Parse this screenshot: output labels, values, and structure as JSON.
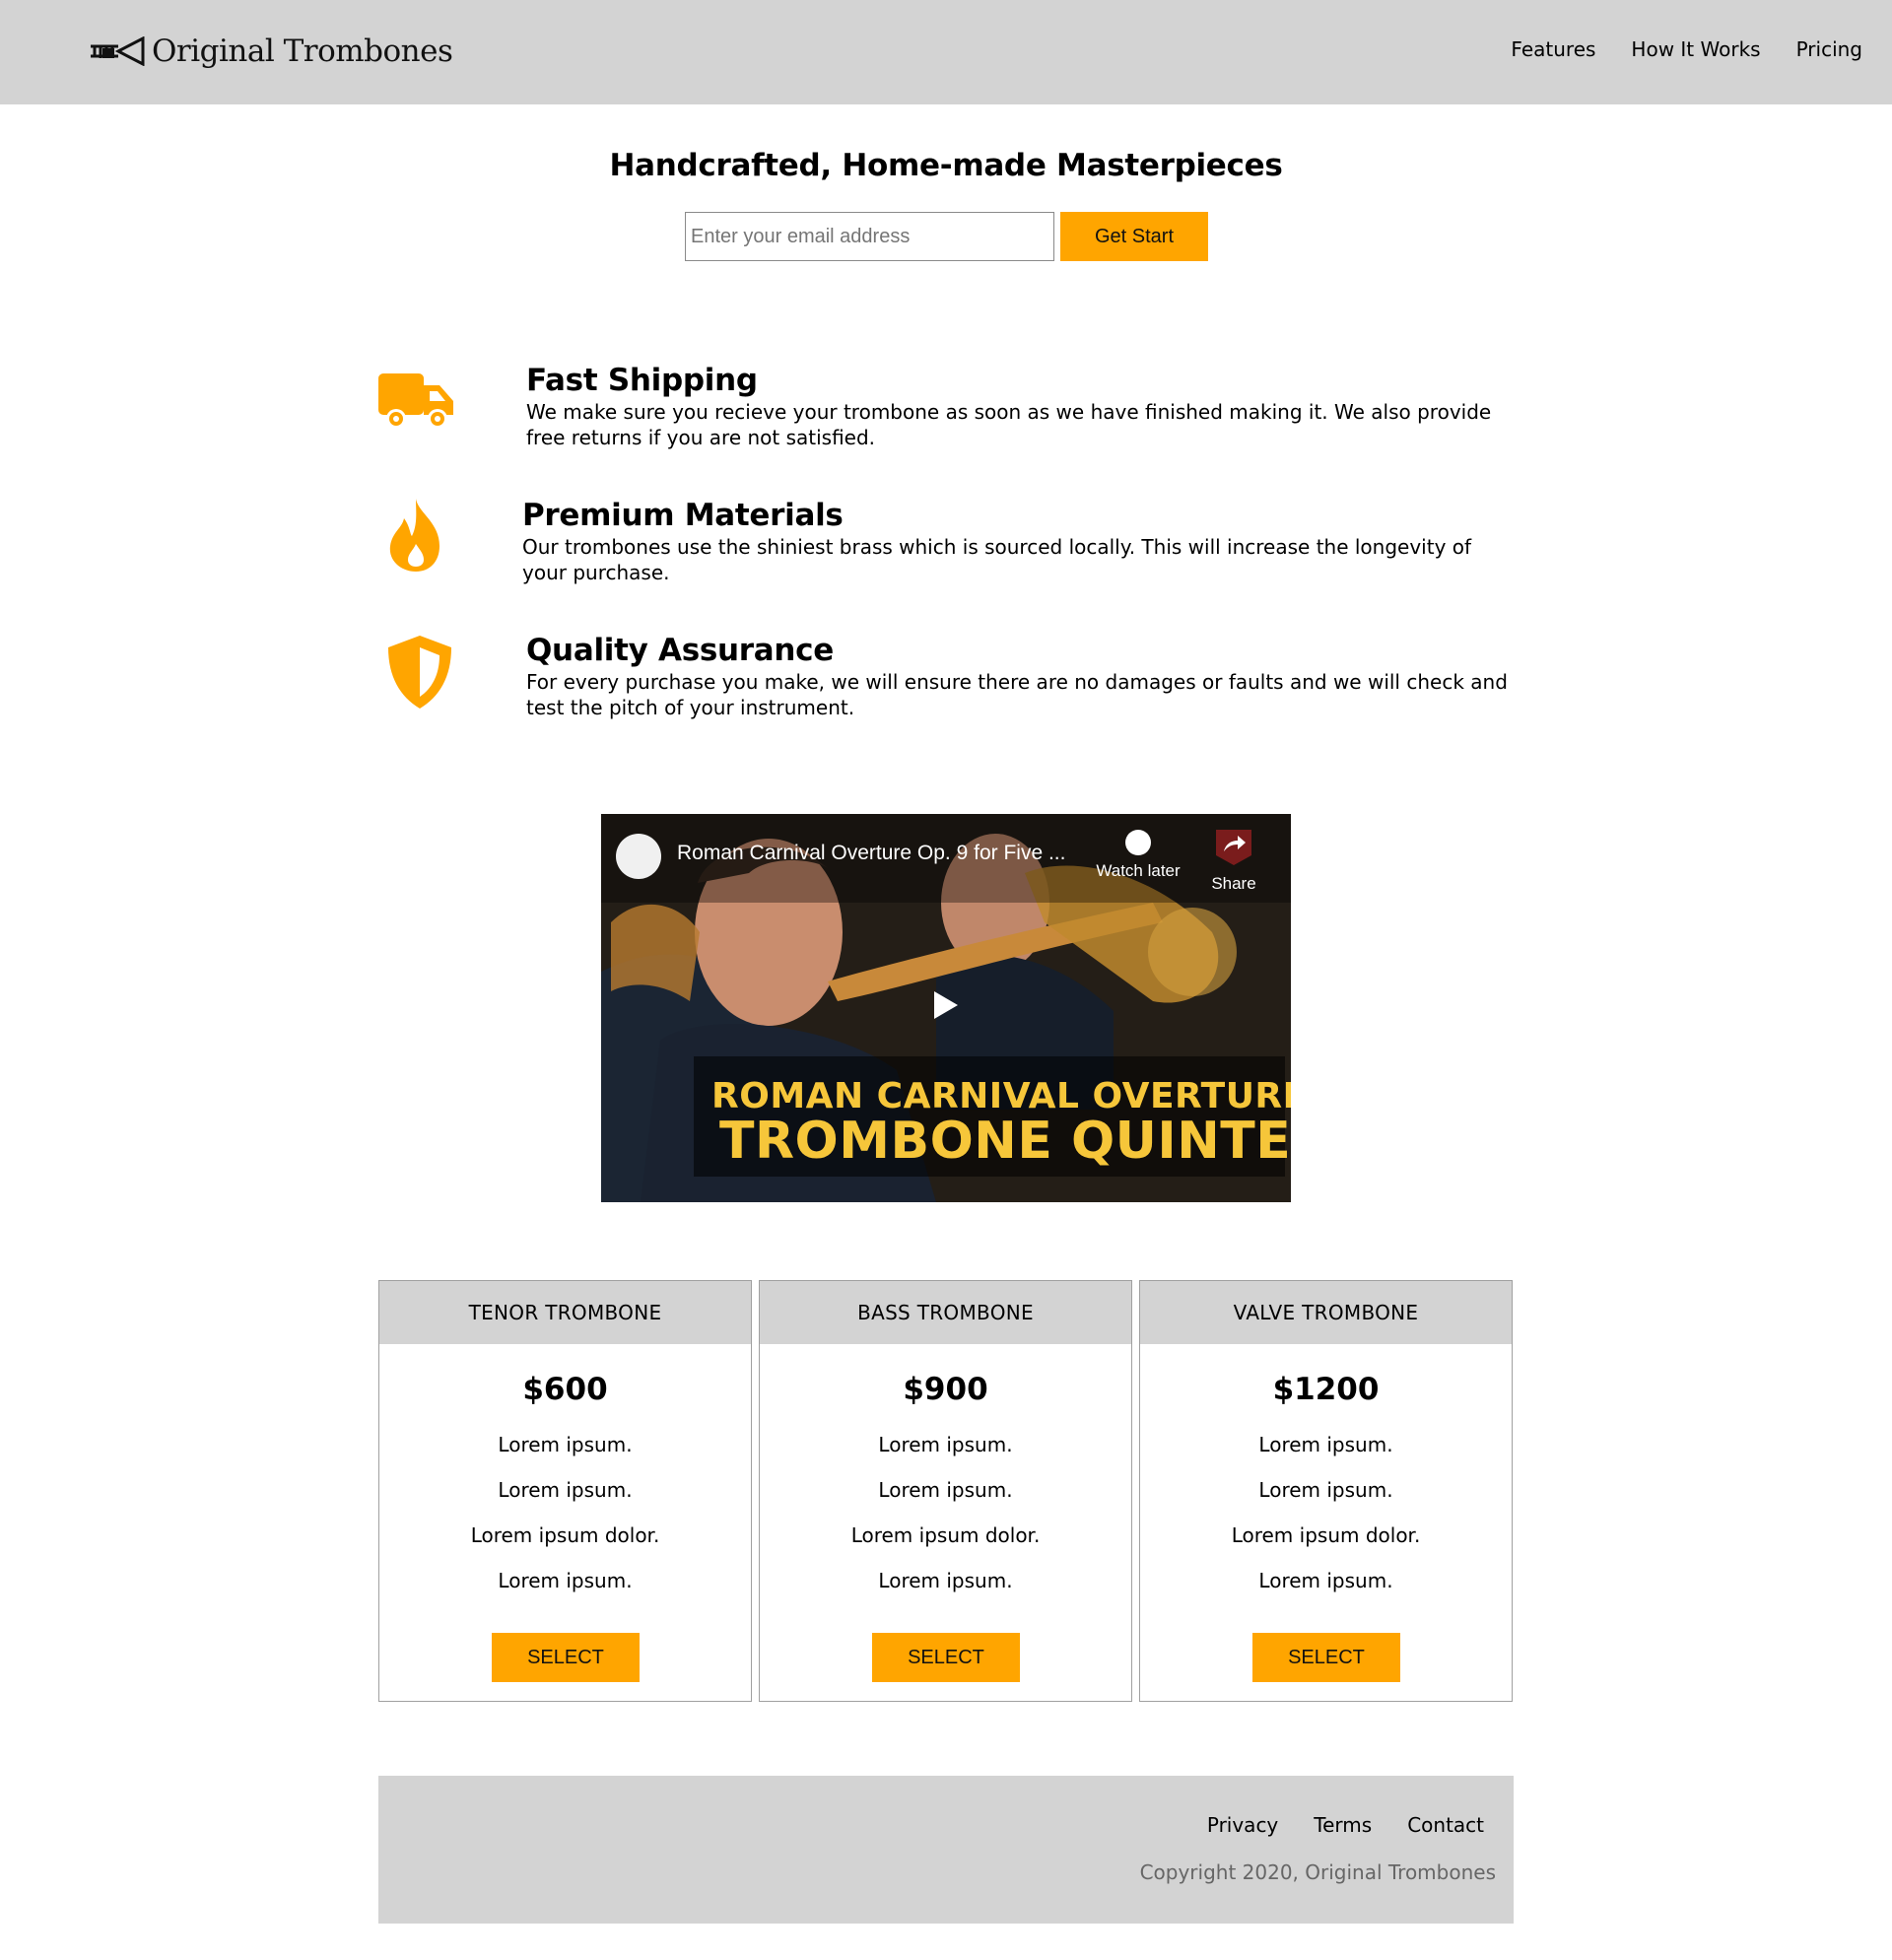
{
  "header": {
    "logo_text": "Original Trombones",
    "nav": [
      {
        "label": "Features"
      },
      {
        "label": "How It Works"
      },
      {
        "label": "Pricing"
      }
    ]
  },
  "hero": {
    "title": "Handcrafted, Home-made Masterpieces",
    "email_placeholder": "Enter your email address",
    "submit_label": "Get Start"
  },
  "features": [
    {
      "icon": "truck-icon",
      "title": "Fast Shipping",
      "text": "We make sure you recieve your trombone as soon as we have finished making it. We also provide free returns if you are not satisfied."
    },
    {
      "icon": "fire-icon",
      "title": "Premium Materials",
      "text": "Our trombones use the shiniest brass which is sourced locally. This will increase the longevity of your purchase."
    },
    {
      "icon": "shield-icon",
      "title": "Quality Assurance",
      "text": "For every purchase you make, we will ensure there are no damages or faults and we will check and test the pitch of your instrument."
    }
  ],
  "video": {
    "title": "Roman Carnival Overture Op. 9 for Five ...",
    "watch_later": "Watch later",
    "share": "Share",
    "banner_line1": "ROMAN CARNIVAL OVERTURE",
    "banner_line2": "TROMBONE QUINTET"
  },
  "plans": [
    {
      "name": "TENOR TROMBONE",
      "price": "$600",
      "features": [
        "Lorem ipsum.",
        "Lorem ipsum.",
        "Lorem ipsum dolor.",
        "Lorem ipsum."
      ],
      "button": "SELECT"
    },
    {
      "name": "BASS TROMBONE",
      "price": "$900",
      "features": [
        "Lorem ipsum.",
        "Lorem ipsum.",
        "Lorem ipsum dolor.",
        "Lorem ipsum."
      ],
      "button": "SELECT"
    },
    {
      "name": "VALVE TROMBONE",
      "price": "$1200",
      "features": [
        "Lorem ipsum.",
        "Lorem ipsum.",
        "Lorem ipsum dolor.",
        "Lorem ipsum."
      ],
      "button": "SELECT"
    }
  ],
  "footer": {
    "links": [
      {
        "label": "Privacy"
      },
      {
        "label": "Terms"
      },
      {
        "label": "Contact"
      }
    ],
    "copyright": "Copyright 2020, Original Trombones"
  },
  "colors": {
    "accent": "#ffa500",
    "header_bg": "#d3d3d3",
    "footer_bg": "#d3d3d3"
  }
}
